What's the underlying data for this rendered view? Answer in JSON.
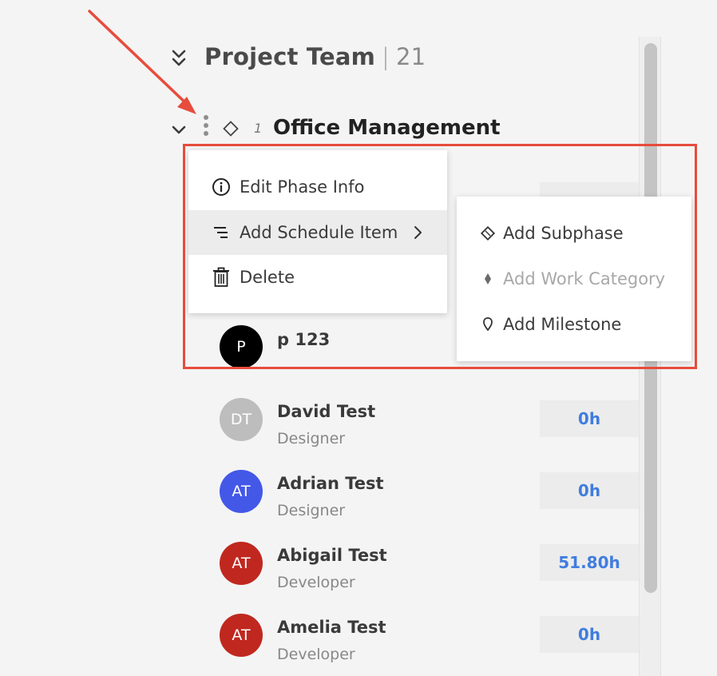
{
  "header": {
    "title": "Project Team",
    "separator": "|",
    "count": "21"
  },
  "phase": {
    "number": "1",
    "title": "Office Management"
  },
  "context_menu": {
    "items": [
      {
        "label": "Edit Phase Info",
        "icon": "info-circle-icon"
      },
      {
        "label": "Add Schedule Item",
        "icon": "schedule-lines-icon",
        "has_submenu": true
      },
      {
        "label": "Delete",
        "icon": "trash-icon"
      }
    ]
  },
  "submenu": {
    "items": [
      {
        "label": "Add Subphase",
        "icon": "subphase-diamond-icon",
        "enabled": true
      },
      {
        "label": "Add Work Category",
        "icon": "work-category-diamond-icon",
        "enabled": false
      },
      {
        "label": "Add Milestone",
        "icon": "milestone-pin-icon",
        "enabled": true
      }
    ]
  },
  "members": [
    {
      "initials": "P",
      "name": "p 123",
      "role": "",
      "hours": "",
      "avatar_color": "#000000"
    },
    {
      "initials": "DT",
      "name": "David Test",
      "role": "Designer",
      "hours": "0h",
      "avatar_color": "#bdbdbd"
    },
    {
      "initials": "AT",
      "name": "Adrian Test",
      "role": "Designer",
      "hours": "0h",
      "avatar_color": "#4458e8"
    },
    {
      "initials": "AT",
      "name": "Abigail Test",
      "role": "Developer",
      "hours": "51.80h",
      "avatar_color": "#c0281f"
    },
    {
      "initials": "AT",
      "name": "Amelia Test",
      "role": "Developer",
      "hours": "0h",
      "avatar_color": "#c0281f"
    }
  ],
  "colors": {
    "accent_blue": "#3f7de0",
    "annotation_red": "#e74c3c"
  }
}
